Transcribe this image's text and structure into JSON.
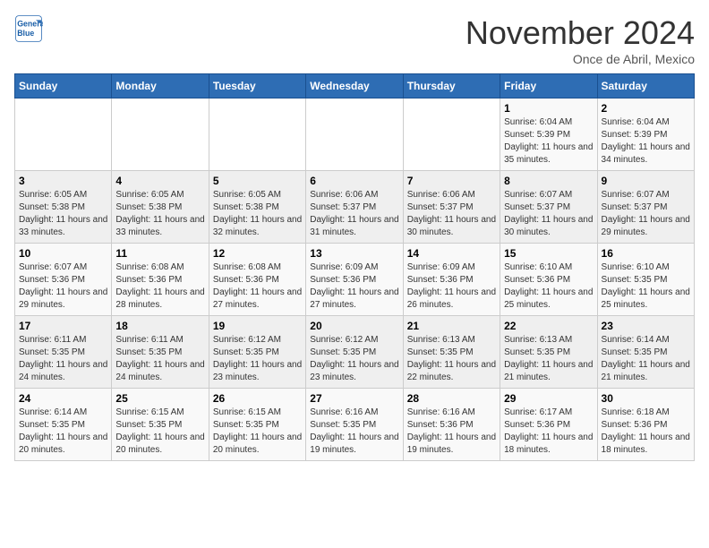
{
  "header": {
    "logo_line1": "General",
    "logo_line2": "Blue",
    "month": "November 2024",
    "location": "Once de Abril, Mexico"
  },
  "days_of_week": [
    "Sunday",
    "Monday",
    "Tuesday",
    "Wednesday",
    "Thursday",
    "Friday",
    "Saturday"
  ],
  "weeks": [
    [
      {
        "day": "",
        "info": ""
      },
      {
        "day": "",
        "info": ""
      },
      {
        "day": "",
        "info": ""
      },
      {
        "day": "",
        "info": ""
      },
      {
        "day": "",
        "info": ""
      },
      {
        "day": "1",
        "info": "Sunrise: 6:04 AM\nSunset: 5:39 PM\nDaylight: 11 hours and 35 minutes."
      },
      {
        "day": "2",
        "info": "Sunrise: 6:04 AM\nSunset: 5:39 PM\nDaylight: 11 hours and 34 minutes."
      }
    ],
    [
      {
        "day": "3",
        "info": "Sunrise: 6:05 AM\nSunset: 5:38 PM\nDaylight: 11 hours and 33 minutes."
      },
      {
        "day": "4",
        "info": "Sunrise: 6:05 AM\nSunset: 5:38 PM\nDaylight: 11 hours and 33 minutes."
      },
      {
        "day": "5",
        "info": "Sunrise: 6:05 AM\nSunset: 5:38 PM\nDaylight: 11 hours and 32 minutes."
      },
      {
        "day": "6",
        "info": "Sunrise: 6:06 AM\nSunset: 5:37 PM\nDaylight: 11 hours and 31 minutes."
      },
      {
        "day": "7",
        "info": "Sunrise: 6:06 AM\nSunset: 5:37 PM\nDaylight: 11 hours and 30 minutes."
      },
      {
        "day": "8",
        "info": "Sunrise: 6:07 AM\nSunset: 5:37 PM\nDaylight: 11 hours and 30 minutes."
      },
      {
        "day": "9",
        "info": "Sunrise: 6:07 AM\nSunset: 5:37 PM\nDaylight: 11 hours and 29 minutes."
      }
    ],
    [
      {
        "day": "10",
        "info": "Sunrise: 6:07 AM\nSunset: 5:36 PM\nDaylight: 11 hours and 29 minutes."
      },
      {
        "day": "11",
        "info": "Sunrise: 6:08 AM\nSunset: 5:36 PM\nDaylight: 11 hours and 28 minutes."
      },
      {
        "day": "12",
        "info": "Sunrise: 6:08 AM\nSunset: 5:36 PM\nDaylight: 11 hours and 27 minutes."
      },
      {
        "day": "13",
        "info": "Sunrise: 6:09 AM\nSunset: 5:36 PM\nDaylight: 11 hours and 27 minutes."
      },
      {
        "day": "14",
        "info": "Sunrise: 6:09 AM\nSunset: 5:36 PM\nDaylight: 11 hours and 26 minutes."
      },
      {
        "day": "15",
        "info": "Sunrise: 6:10 AM\nSunset: 5:36 PM\nDaylight: 11 hours and 25 minutes."
      },
      {
        "day": "16",
        "info": "Sunrise: 6:10 AM\nSunset: 5:35 PM\nDaylight: 11 hours and 25 minutes."
      }
    ],
    [
      {
        "day": "17",
        "info": "Sunrise: 6:11 AM\nSunset: 5:35 PM\nDaylight: 11 hours and 24 minutes."
      },
      {
        "day": "18",
        "info": "Sunrise: 6:11 AM\nSunset: 5:35 PM\nDaylight: 11 hours and 24 minutes."
      },
      {
        "day": "19",
        "info": "Sunrise: 6:12 AM\nSunset: 5:35 PM\nDaylight: 11 hours and 23 minutes."
      },
      {
        "day": "20",
        "info": "Sunrise: 6:12 AM\nSunset: 5:35 PM\nDaylight: 11 hours and 23 minutes."
      },
      {
        "day": "21",
        "info": "Sunrise: 6:13 AM\nSunset: 5:35 PM\nDaylight: 11 hours and 22 minutes."
      },
      {
        "day": "22",
        "info": "Sunrise: 6:13 AM\nSunset: 5:35 PM\nDaylight: 11 hours and 21 minutes."
      },
      {
        "day": "23",
        "info": "Sunrise: 6:14 AM\nSunset: 5:35 PM\nDaylight: 11 hours and 21 minutes."
      }
    ],
    [
      {
        "day": "24",
        "info": "Sunrise: 6:14 AM\nSunset: 5:35 PM\nDaylight: 11 hours and 20 minutes."
      },
      {
        "day": "25",
        "info": "Sunrise: 6:15 AM\nSunset: 5:35 PM\nDaylight: 11 hours and 20 minutes."
      },
      {
        "day": "26",
        "info": "Sunrise: 6:15 AM\nSunset: 5:35 PM\nDaylight: 11 hours and 20 minutes."
      },
      {
        "day": "27",
        "info": "Sunrise: 6:16 AM\nSunset: 5:35 PM\nDaylight: 11 hours and 19 minutes."
      },
      {
        "day": "28",
        "info": "Sunrise: 6:16 AM\nSunset: 5:36 PM\nDaylight: 11 hours and 19 minutes."
      },
      {
        "day": "29",
        "info": "Sunrise: 6:17 AM\nSunset: 5:36 PM\nDaylight: 11 hours and 18 minutes."
      },
      {
        "day": "30",
        "info": "Sunrise: 6:18 AM\nSunset: 5:36 PM\nDaylight: 11 hours and 18 minutes."
      }
    ]
  ]
}
